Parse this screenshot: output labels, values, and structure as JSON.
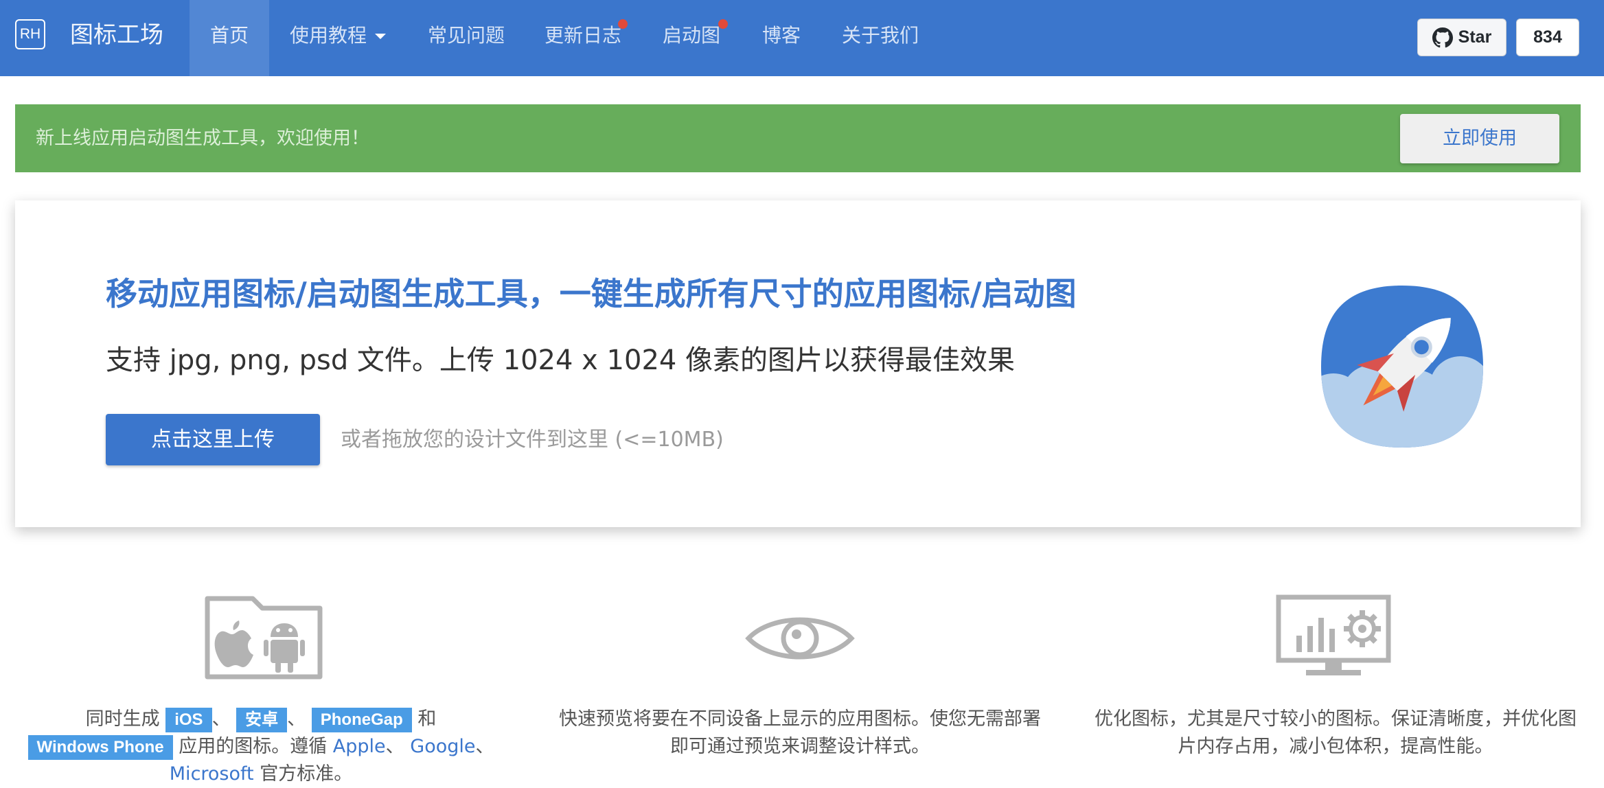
{
  "brand": {
    "logo_text": "RH",
    "name": "图标工场"
  },
  "nav": {
    "items": [
      {
        "label": "首页"
      },
      {
        "label": "使用教程"
      },
      {
        "label": "常见问题"
      },
      {
        "label": "更新日志"
      },
      {
        "label": "启动图"
      },
      {
        "label": "博客"
      },
      {
        "label": "关于我们"
      }
    ],
    "active": "首页"
  },
  "github": {
    "star_label": "Star",
    "star_count": "834"
  },
  "announcement": {
    "text": "新上线应用启动图生成工具，欢迎使用！",
    "button": "立即使用"
  },
  "hero": {
    "title": "移动应用图标/启动图生成工具，一键生成所有尺寸的应用图标/启动图",
    "subtitle": "支持 jpg, png, psd 文件。上传 1024 x 1024 像素的图片以获得最佳效果",
    "upload_button": "点击这里上传",
    "drop_hint": "或者拖放您的设计文件到这里 (<=10MB)"
  },
  "features": [
    {
      "icon": "folder-apple-android-icon",
      "prefix": "同时生成",
      "tags": [
        "iOS",
        "安卓",
        "PhoneGap",
        "Windows Phone"
      ],
      "sep1": "、",
      "sep2": "、",
      "and": "和",
      "middle": "应用的图标。遵循",
      "links": [
        "Apple",
        "Google",
        "Microsoft"
      ],
      "link_sep1": "、",
      "link_sep2": "、",
      "suffix": "官方标准。"
    },
    {
      "icon": "eye-icon",
      "text": "快速预览将要在不同设备上显示的应用图标。使您无需部署即可通过预览来调整设计样式。"
    },
    {
      "icon": "monitor-chart-gear-icon",
      "text": "优化图标，尤其是尺寸较小的图标。保证清晰度，并优化图片内存占用，减小包体积，提高性能。"
    }
  ],
  "colors": {
    "primary": "#3b76cc",
    "announce_bg": "#67ad5b",
    "tag_bg": "#4a9ce5",
    "notice_dot": "#e04a3a"
  }
}
